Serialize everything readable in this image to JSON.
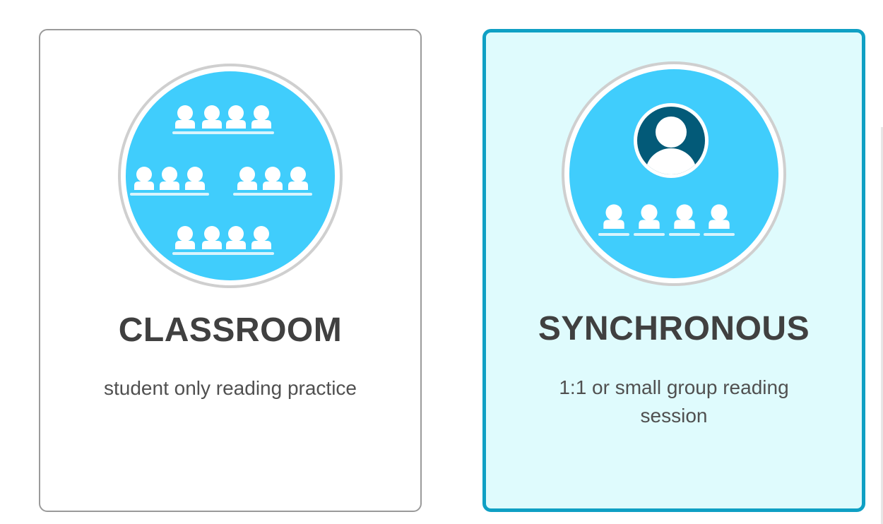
{
  "cards": [
    {
      "id": "classroom",
      "title": "CLASSROOM",
      "description": "student only reading practice",
      "icon": "classroom-groups-icon",
      "selected": false
    },
    {
      "id": "synchronous",
      "title": "SYNCHRONOUS",
      "description": "1:1 or small group reading session",
      "icon": "teacher-with-students-icon",
      "selected": true
    }
  ],
  "colors": {
    "icon_circle": "#40cdfc",
    "icon_ring": "#cfcfcf",
    "person": "#ffffff",
    "teacher_bg": "#035a78",
    "selected_border": "#0fa0c4",
    "selected_bg": "#dffbfd",
    "default_border": "#9a9a9a",
    "title_text": "#404040",
    "desc_text": "#505050"
  }
}
